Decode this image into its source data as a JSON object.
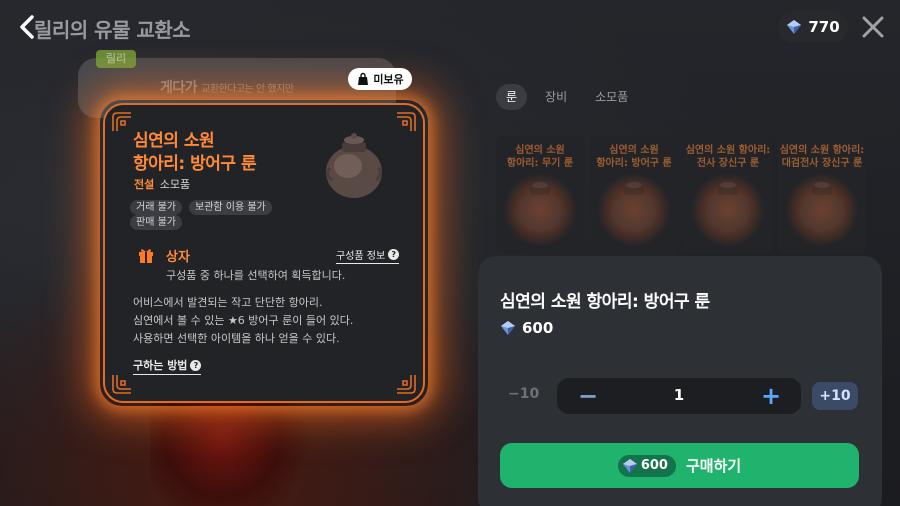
{
  "header": {
    "title": "릴리의 유물 교환소",
    "currency_amount": "770"
  },
  "speech": {
    "tag": "릴리",
    "text": "게다가",
    "subtext": "교환한다고는 안 했지만"
  },
  "item_card": {
    "not_owned_label": "미보유",
    "name_line1": "심연의 소원",
    "name_line2": "항아리: 방어구 룬",
    "grade": "전설",
    "type": "소모품",
    "tags": [
      "거래 불가",
      "보관함 이용 불가",
      "판매 불가"
    ],
    "box_title": "상자",
    "composition_info": "구성품 정보",
    "box_description": "구성품 중 하나를 선택하여 획득합니다.",
    "description": [
      "어비스에서 발견되는 작고 단단한 항아리.",
      "심연에서 볼 수 있는 ★6 방어구 룬이 들어 있다.",
      "사용하면 선택한 아이템을 하나 얻을 수 있다."
    ],
    "how_to_get": "구하는 방법"
  },
  "store": {
    "tabs": [
      "룬",
      "장비",
      "소모품"
    ],
    "active_tab": "룬",
    "slots": [
      {
        "line1": "심연의 소원",
        "line2": "항아리: 무기 룬"
      },
      {
        "line1": "심연의 소원",
        "line2": "항아리: 방어구 룬"
      },
      {
        "line1": "심연의 소원 항아리:",
        "line2": "전사 장신구 룬"
      },
      {
        "line1": "심연의 소원 항아리:",
        "line2": "대검전사 장신구 룬"
      }
    ]
  },
  "purchase": {
    "item_name": "심연의 소원 항아리: 방어구 룬",
    "price": "600",
    "minus10": "−10",
    "quantity": "1",
    "plus10": "+10",
    "buy_price": "600",
    "buy_label": "구매하기"
  },
  "colors": {
    "accent_orange": "#ff8a3a",
    "buy_green": "#1fb36d",
    "card_border": "#e26c23"
  },
  "icons": [
    "back-icon",
    "gem-icon",
    "close-icon",
    "gift-box-icon",
    "question-icon",
    "jar-icon",
    "minus-icon",
    "plus-icon",
    "bag-icon"
  ]
}
